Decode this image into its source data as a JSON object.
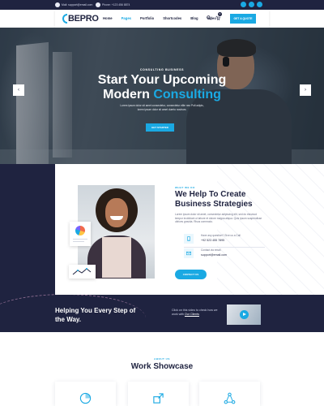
{
  "topbar": {
    "email": "Mail: support@email.com",
    "phone": "Phone: +123 456 8874",
    "socials": [
      "facebook-icon",
      "twitter-icon",
      "linkedin-icon"
    ]
  },
  "header": {
    "logo": "BEPRO",
    "nav": [
      "Home",
      "Pages",
      "Portfolio",
      "Shortcodes",
      "Blog",
      "Video"
    ],
    "active_nav": "Pages",
    "cart_count": "0",
    "quote_label": "GET A QUOTE"
  },
  "hero": {
    "subtitle": "CONSULTING BUSINESS",
    "title_line1": "Start Your Upcoming",
    "title_line2_plain": "Modern",
    "title_line2_accent": "Consulting",
    "description": "Lorem ipsum dolor sit amet consectetur, consectetur elite neo Polt adipis, lorem ipsum dolor sit amet duerto nostrum.",
    "button": "GET STARTED",
    "prev_arrow": "‹",
    "next_arrow": "›"
  },
  "about": {
    "tag": "WHAT WE DO",
    "title_line1": "We Help To Create",
    "title_line2": "Business Strategies",
    "text": "Lorem ipsum dolor sit amet, consectetur adipiscing elit, sed do eiusmod tempor incididunt ut labore et dolore magna aliqua. Quis ipsum suspendisse ultrices gravida. Risus commodo.",
    "contacts": [
      {
        "icon": "phone-icon",
        "label": "Have any question? Give us a Call",
        "value": "+92 523 455 7895"
      },
      {
        "icon": "mail-icon",
        "label": "Contact via email",
        "value": "support@email.com"
      }
    ],
    "button": "CONTACT US"
  },
  "help": {
    "title_line1": "Helping You Every Step of",
    "title_line2": "the Way.",
    "text_before": "Click on this video to check how we work with",
    "text_link": "Our Clients"
  },
  "work": {
    "tag": "ABOUT US",
    "title": "Work Showcase",
    "cards": [
      "chart-pie-icon",
      "expand-arrows-icon",
      "network-icon"
    ]
  },
  "colors": {
    "accent": "#1aa9e3",
    "dark": "#1f2340"
  }
}
